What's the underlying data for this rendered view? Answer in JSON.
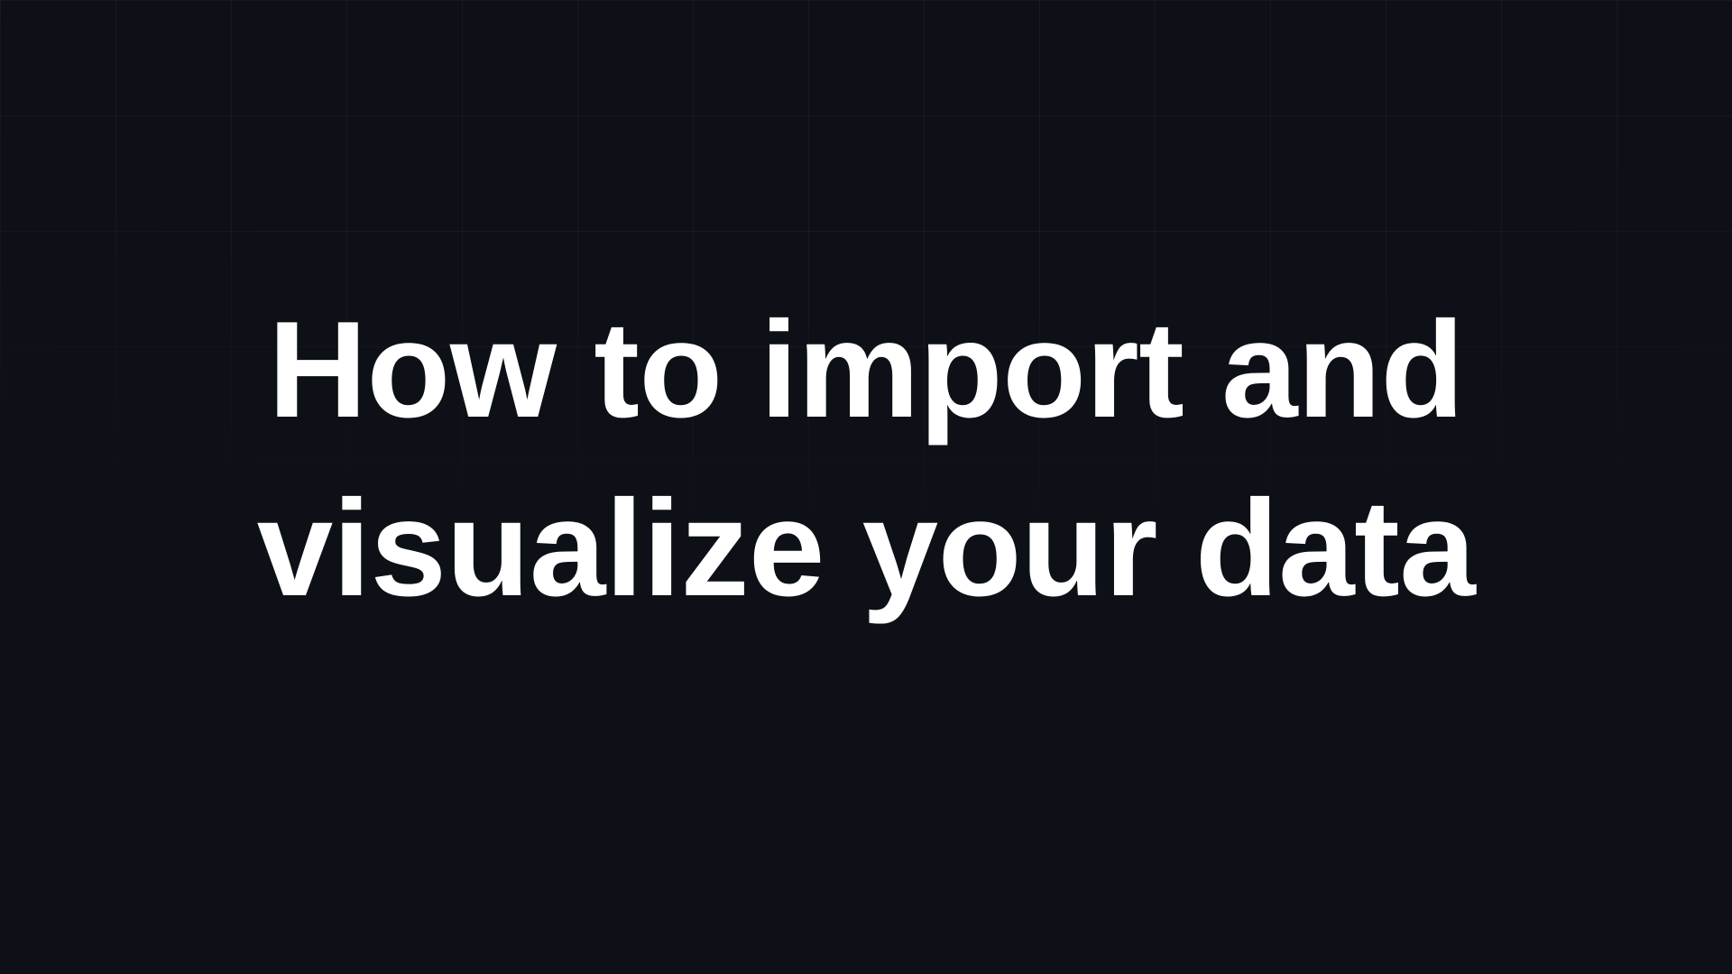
{
  "slide": {
    "title": "How to import and visualize your data"
  },
  "theme": {
    "background": "#0d1117",
    "text_color": "#ffffff",
    "grid_color": "rgba(255, 255, 255, 0.04)"
  }
}
